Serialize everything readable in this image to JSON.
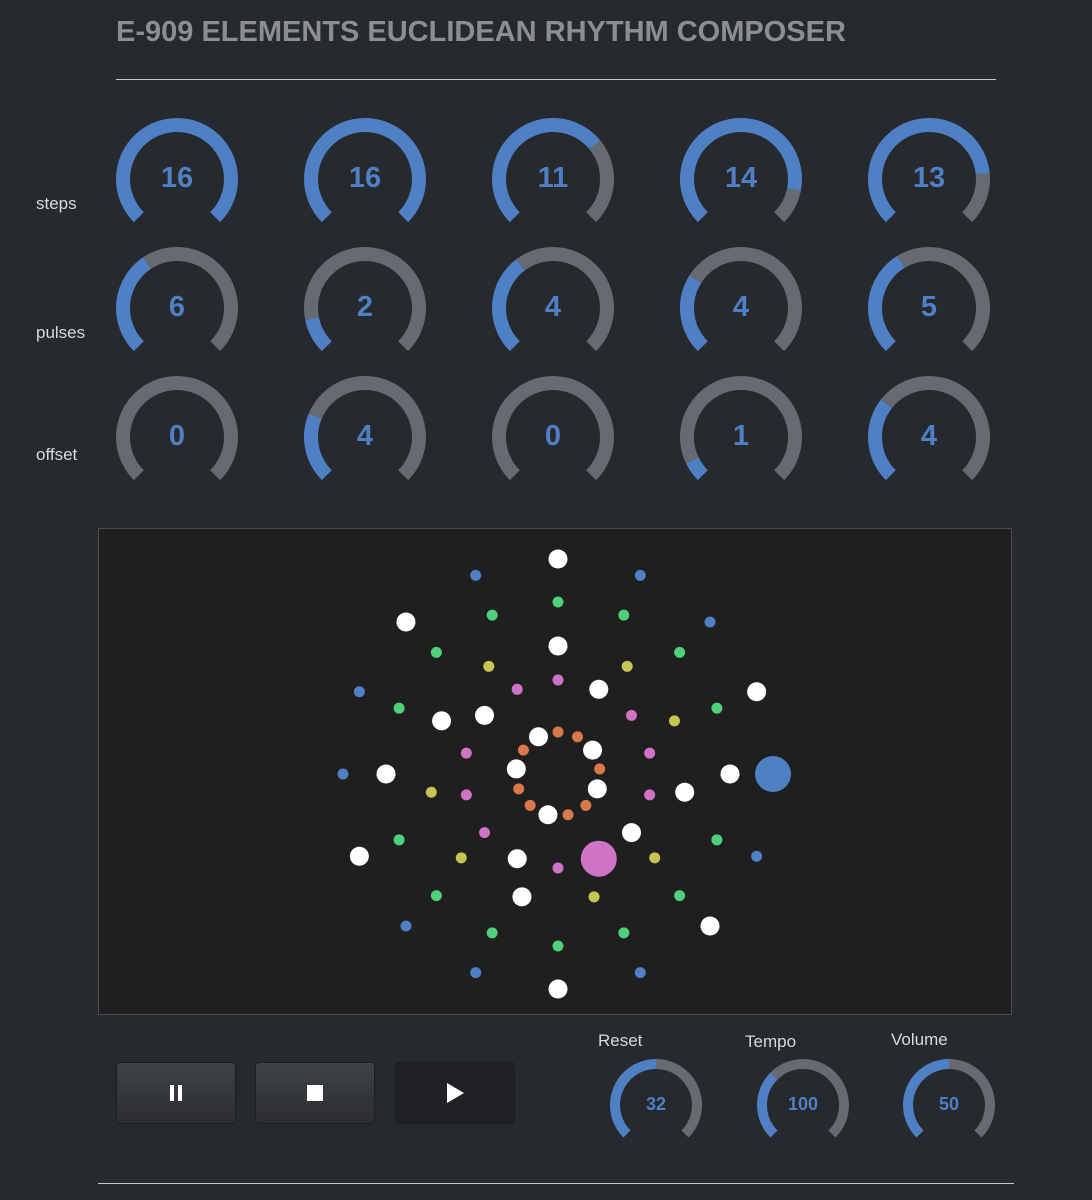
{
  "header": {
    "title": "E-909 ELEMENTS EUCLIDEAN RHYTHM COMPOSER"
  },
  "rows": {
    "steps": {
      "label": "steps",
      "max": 16,
      "values": [
        16,
        16,
        11,
        14,
        13
      ]
    },
    "pulses": {
      "label": "pulses",
      "values": [
        6,
        2,
        4,
        4,
        5
      ]
    },
    "offset": {
      "label": "offset",
      "values": [
        0,
        4,
        0,
        1,
        4
      ]
    }
  },
  "controls": {
    "pause_icon": "pause-icon",
    "stop_icon": "stop-icon",
    "play_icon": "play-icon",
    "reset": {
      "label": "Reset",
      "value": 32,
      "max": 64
    },
    "tempo": {
      "label": "Tempo",
      "value": 100,
      "max": 300
    },
    "volume": {
      "label": "Volume",
      "value": 50,
      "max": 100
    }
  },
  "colors": {
    "accent": "#4f80c4",
    "track_off": "#676b71",
    "ring_steps": "#4f80c4",
    "ring_2": "#4fd07a",
    "ring_3": "#c6c452",
    "ring_4": "#cf73c6",
    "ring_5": "#d9784a",
    "active_pulse": "#ffffff"
  },
  "sequencer": {
    "rings": [
      {
        "steps": 16,
        "pulses": 6,
        "offset": 0,
        "color": "#4f80c4",
        "playhead": 4
      },
      {
        "steps": 16,
        "pulses": 2,
        "offset": 4,
        "color": "#4fd07a",
        "playhead": -1
      },
      {
        "steps": 11,
        "pulses": 4,
        "offset": 0,
        "color": "#c6c452",
        "playhead": -1
      },
      {
        "steps": 14,
        "pulses": 4,
        "offset": 1,
        "color": "#cf73c6",
        "playhead": 6
      },
      {
        "steps": 13,
        "pulses": 5,
        "offset": 4,
        "color": "#d9784a",
        "playhead": -1
      }
    ]
  }
}
